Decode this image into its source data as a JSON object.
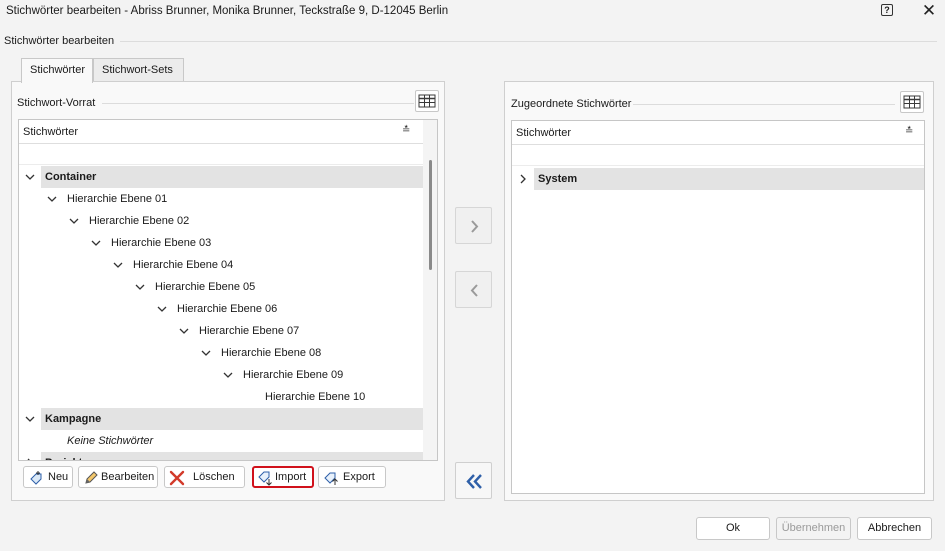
{
  "window": {
    "title": "Stichwörter bearbeiten - Abriss Brunner, Monika Brunner, Teckstraße 9, D-12045 Berlin",
    "help_label": "?",
    "close_label": "✕"
  },
  "section_label": "Stichwörter bearbeiten",
  "tabs": [
    {
      "label": "Stichwörter",
      "active": true
    },
    {
      "label": "Stichwort-Sets",
      "active": false
    }
  ],
  "left_panel": {
    "caption": "Stichwort-Vorrat",
    "column_header": "Stichwörter",
    "rows": [
      {
        "type": "group",
        "label": "Container",
        "expanded": true,
        "level": 0
      },
      {
        "type": "item",
        "label": "Hierarchie Ebene 01",
        "expanded": true,
        "level": 1
      },
      {
        "type": "item",
        "label": "Hierarchie Ebene 02",
        "expanded": true,
        "level": 2
      },
      {
        "type": "item",
        "label": "Hierarchie Ebene 03",
        "expanded": true,
        "level": 3
      },
      {
        "type": "item",
        "label": "Hierarchie Ebene 04",
        "expanded": true,
        "level": 4
      },
      {
        "type": "item",
        "label": "Hierarchie Ebene 05",
        "expanded": true,
        "level": 5
      },
      {
        "type": "item",
        "label": "Hierarchie Ebene 06",
        "expanded": true,
        "level": 6
      },
      {
        "type": "item",
        "label": "Hierarchie Ebene 07",
        "expanded": true,
        "level": 7
      },
      {
        "type": "item",
        "label": "Hierarchie Ebene 08",
        "expanded": true,
        "level": 8
      },
      {
        "type": "item",
        "label": "Hierarchie Ebene 09",
        "expanded": true,
        "level": 9
      },
      {
        "type": "leaf",
        "label": "Hierarchie Ebene 10",
        "level": 10
      },
      {
        "type": "group",
        "label": "Kampagne",
        "expanded": true,
        "level": 0
      },
      {
        "type": "empty",
        "label": "Keine Stichwörter",
        "level": 1
      },
      {
        "type": "group",
        "label": "Projekt",
        "expanded": false,
        "level": 0
      }
    ],
    "buttons": {
      "new": "Neu",
      "edit": "Bearbeiten",
      "delete": "Löschen",
      "import": "Import",
      "export": "Export"
    }
  },
  "right_panel": {
    "caption": "Zugeordnete Stichwörter",
    "column_header": "Stichwörter",
    "rows": [
      {
        "type": "group",
        "label": "System",
        "expanded": false
      }
    ]
  },
  "dialog_buttons": {
    "ok": "Ok",
    "apply": "Übernehmen",
    "cancel": "Abbrechen"
  },
  "colors": {
    "highlight": "#d0111b",
    "accent_arrow": "#2e5fa8",
    "group_band": "#e3e3e3"
  }
}
